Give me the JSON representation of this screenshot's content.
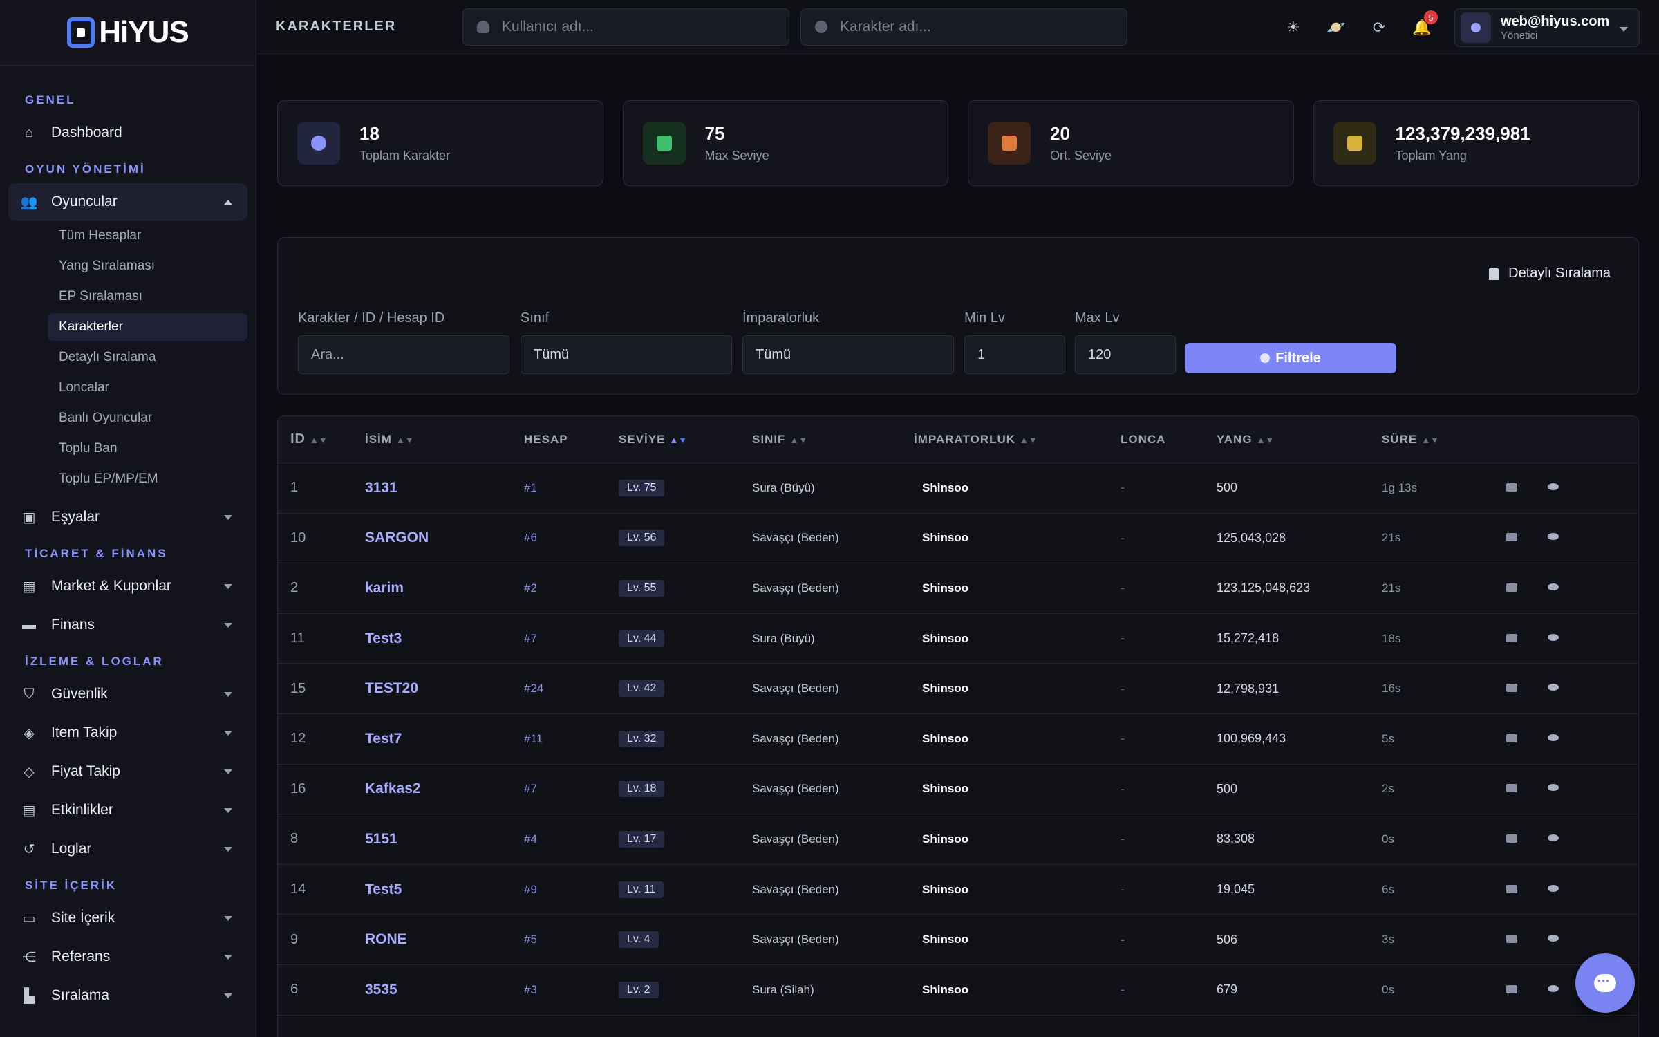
{
  "brand": {
    "logo_text": "HiYUS"
  },
  "topbar": {
    "page_title": "KARAKTERLER",
    "user_search_placeholder": "Kullanıcı adı...",
    "character_search_placeholder": "Karakter adı...",
    "notification_count": "5",
    "user_email": "web@hiyus.com",
    "user_role": "Yönetici"
  },
  "sidebar": {
    "sections": {
      "general": "GENEL",
      "game": "OYUN YÖNETİMİ",
      "trade": "TİCARET & FİNANS",
      "logs": "İZLEME & LOGLAR",
      "site": "SİTE İÇERİK"
    },
    "dashboard": "Dashboard",
    "players": "Oyuncular",
    "players_sub": [
      "Tüm Hesaplar",
      "Yang Sıralaması",
      "EP Sıralaması",
      "Karakterler",
      "Detaylı Sıralama",
      "Loncalar",
      "Banlı Oyuncular",
      "Toplu Ban",
      "Toplu EP/MP/EM"
    ],
    "items": "Eşyalar",
    "market": "Market & Kuponlar",
    "finance": "Finans",
    "security": "Güvenlik",
    "item_tracking": "Item Takip",
    "price_tracking": "Fiyat Takip",
    "events": "Etkinlikler",
    "logs_item": "Loglar",
    "site_content": "Site İçerik",
    "references": "Referans",
    "ranking": "Sıralama"
  },
  "stats": [
    {
      "value": "18",
      "label": "Toplam Karakter",
      "color": "#8b93ff"
    },
    {
      "value": "75",
      "label": "Max Seviye",
      "color": "#3fbf6f"
    },
    {
      "value": "20",
      "label": "Ort. Seviye",
      "color": "#e07a3a"
    },
    {
      "value": "123,379,239,981",
      "label": "Toplam Yang",
      "color": "#d6b23a"
    }
  ],
  "filters": {
    "detail_link": "Detaylı Sıralama",
    "search_label": "Karakter / ID / Hesap ID",
    "search_placeholder": "Ara...",
    "class_label": "Sınıf",
    "class_value": "Tümü",
    "empire_label": "İmparatorluk",
    "empire_value": "Tümü",
    "min_label": "Min Lv",
    "min_value": "1",
    "max_label": "Max Lv",
    "max_value": "120",
    "button": "Filtrele"
  },
  "table": {
    "headers": {
      "id": "ID",
      "name": "İSİM",
      "account": "HESAP",
      "level": "SEVİYE",
      "class": "SINIF",
      "empire": "İMPARATORLUK",
      "guild": "LONCA",
      "yang": "YANG",
      "time": "SÜRE"
    },
    "rows": [
      {
        "id": "1",
        "name": "3131",
        "account": "#1",
        "level": "Lv. 75",
        "class": "Sura (Büyü)",
        "empire": "Shinsoo",
        "guild": "-",
        "yang": "500",
        "time": "1g 13s"
      },
      {
        "id": "10",
        "name": "SARGON",
        "account": "#6",
        "level": "Lv. 56",
        "class": "Savaşçı (Beden)",
        "empire": "Shinsoo",
        "guild": "-",
        "yang": "125,043,028",
        "time": "21s"
      },
      {
        "id": "2",
        "name": "karim",
        "account": "#2",
        "level": "Lv. 55",
        "class": "Savaşçı (Beden)",
        "empire": "Shinsoo",
        "guild": "-",
        "yang": "123,125,048,623",
        "time": "21s"
      },
      {
        "id": "11",
        "name": "Test3",
        "account": "#7",
        "level": "Lv. 44",
        "class": "Sura (Büyü)",
        "empire": "Shinsoo",
        "guild": "-",
        "yang": "15,272,418",
        "time": "18s"
      },
      {
        "id": "15",
        "name": "TEST20",
        "account": "#24",
        "level": "Lv. 42",
        "class": "Savaşçı (Beden)",
        "empire": "Shinsoo",
        "guild": "-",
        "yang": "12,798,931",
        "time": "16s"
      },
      {
        "id": "12",
        "name": "Test7",
        "account": "#11",
        "level": "Lv. 32",
        "class": "Savaşçı (Beden)",
        "empire": "Shinsoo",
        "guild": "-",
        "yang": "100,969,443",
        "time": "5s"
      },
      {
        "id": "16",
        "name": "Kafkas2",
        "account": "#7",
        "level": "Lv. 18",
        "class": "Savaşçı (Beden)",
        "empire": "Shinsoo",
        "guild": "-",
        "yang": "500",
        "time": "2s"
      },
      {
        "id": "8",
        "name": "5151",
        "account": "#4",
        "level": "Lv. 17",
        "class": "Savaşçı (Beden)",
        "empire": "Shinsoo",
        "guild": "-",
        "yang": "83,308",
        "time": "0s"
      },
      {
        "id": "14",
        "name": "Test5",
        "account": "#9",
        "level": "Lv. 11",
        "class": "Savaşçı (Beden)",
        "empire": "Shinsoo",
        "guild": "-",
        "yang": "19,045",
        "time": "6s"
      },
      {
        "id": "9",
        "name": "RONE",
        "account": "#5",
        "level": "Lv. 4",
        "class": "Savaşçı (Beden)",
        "empire": "Shinsoo",
        "guild": "-",
        "yang": "506",
        "time": "3s"
      },
      {
        "id": "6",
        "name": "3535",
        "account": "#3",
        "level": "Lv. 2",
        "class": "Sura (Silah)",
        "empire": "Shinsoo",
        "guild": "-",
        "yang": "679",
        "time": "0s"
      }
    ]
  },
  "colors": {
    "accent": "#7d86f6",
    "background": "#0c0d12",
    "panel": "#111218"
  }
}
